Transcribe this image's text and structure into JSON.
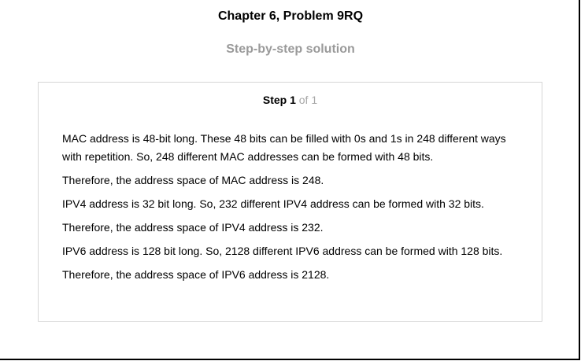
{
  "header": {
    "title": "Chapter 6, Problem 9RQ",
    "subtitle": "Step-by-step solution"
  },
  "step": {
    "label": "Step 1",
    "of_text": "of 1"
  },
  "paragraphs": [
    "MAC address is 48-bit long. These 48 bits can be filled with 0s and 1s in 248 different ways with repetition. So, 248 different MAC addresses can be formed with 48 bits.",
    "Therefore, the address space of MAC address is 248.",
    "IPV4 address is 32 bit long. So, 232 different IPV4 address can be formed with 32 bits.",
    "Therefore, the address space of IPV4 address is 232.",
    "IPV6 address is 128 bit long. So, 2128 different IPV6 address can be formed with 128 bits.",
    "Therefore, the address space of IPV6 address is 2128."
  ]
}
